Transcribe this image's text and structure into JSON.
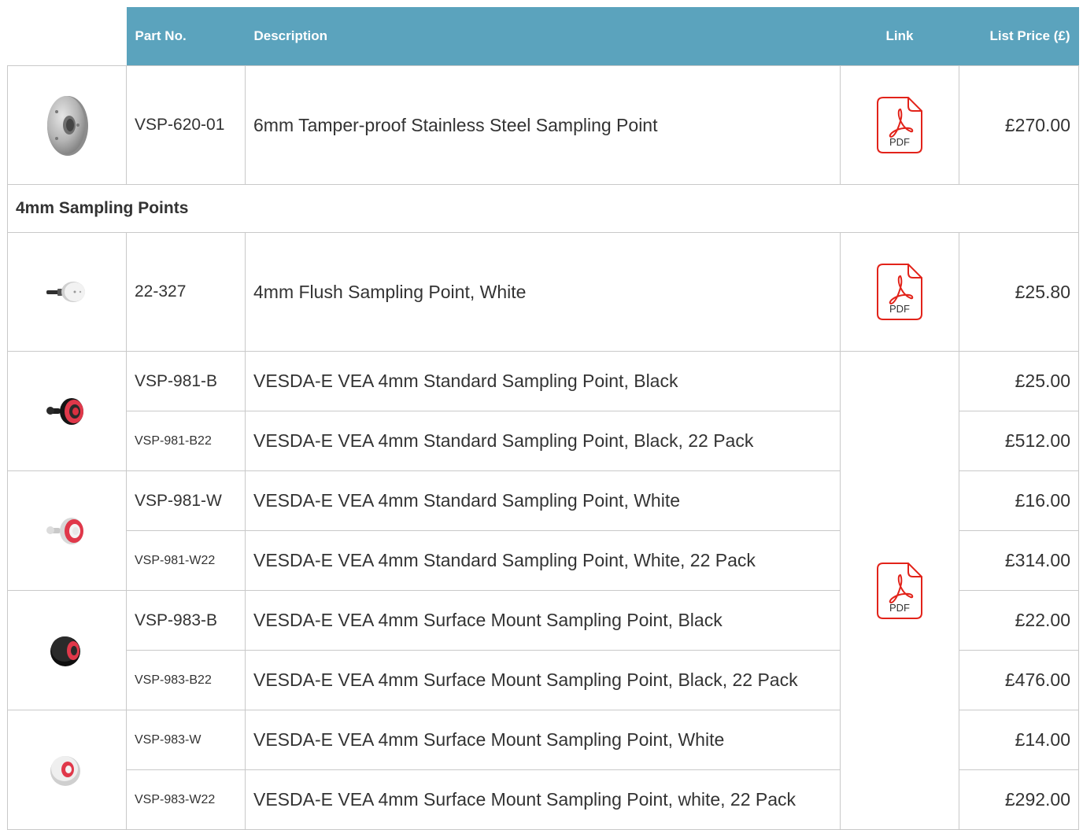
{
  "header": {
    "part_no": "Part No.",
    "description": "Description",
    "link": "Link",
    "list_price": "List Price (£)"
  },
  "pdf_label": "PDF",
  "colors": {
    "header_bg": "#5ba3bd",
    "border": "#c9c9c9",
    "pdf_red": "#e2231a"
  },
  "rows": [
    {
      "part": "VSP-620-01",
      "description": "6mm Tamper-proof Stainless Steel Sampling Point",
      "price": "£270.00",
      "image": "steel-flange-sampling-point-image"
    },
    {
      "section": "4mm Sampling Points"
    },
    {
      "part": "22-327",
      "description": "4mm Flush Sampling Point, White",
      "price": "£25.80",
      "image": "white-flush-sampling-point-image"
    },
    {
      "part": "VSP-981-B",
      "description": "VESDA-E VEA 4mm Standard Sampling Point, Black",
      "price": "£25.00",
      "image": "black-standard-sampling-point-image"
    },
    {
      "part": "VSP-981-B22",
      "description": "VESDA-E VEA 4mm Standard Sampling Point, Black, 22 Pack",
      "price": "£512.00"
    },
    {
      "part": "VSP-981-W",
      "description": "VESDA-E VEA 4mm Standard Sampling Point, White",
      "price": "£16.00",
      "image": "white-standard-sampling-point-image"
    },
    {
      "part": "VSP-981-W22",
      "description": "VESDA-E VEA 4mm Standard Sampling Point, White, 22 Pack",
      "price": "£314.00"
    },
    {
      "part": "VSP-983-B",
      "description": "VESDA-E VEA 4mm Surface Mount Sampling Point, Black",
      "price": "£22.00",
      "image": "black-surface-mount-sampling-point-image"
    },
    {
      "part": "VSP-983-B22",
      "description": "VESDA-E VEA 4mm Surface Mount Sampling Point, Black, 22 Pack",
      "price": "£476.00"
    },
    {
      "part": "VSP-983-W",
      "description": "VESDA-E VEA 4mm Surface Mount Sampling Point, White",
      "price": "£14.00",
      "image": "white-surface-mount-sampling-point-image"
    },
    {
      "part": "VSP-983-W22",
      "description": "VESDA-E VEA 4mm Surface Mount Sampling Point, white, 22 Pack",
      "price": "£292.00"
    }
  ]
}
